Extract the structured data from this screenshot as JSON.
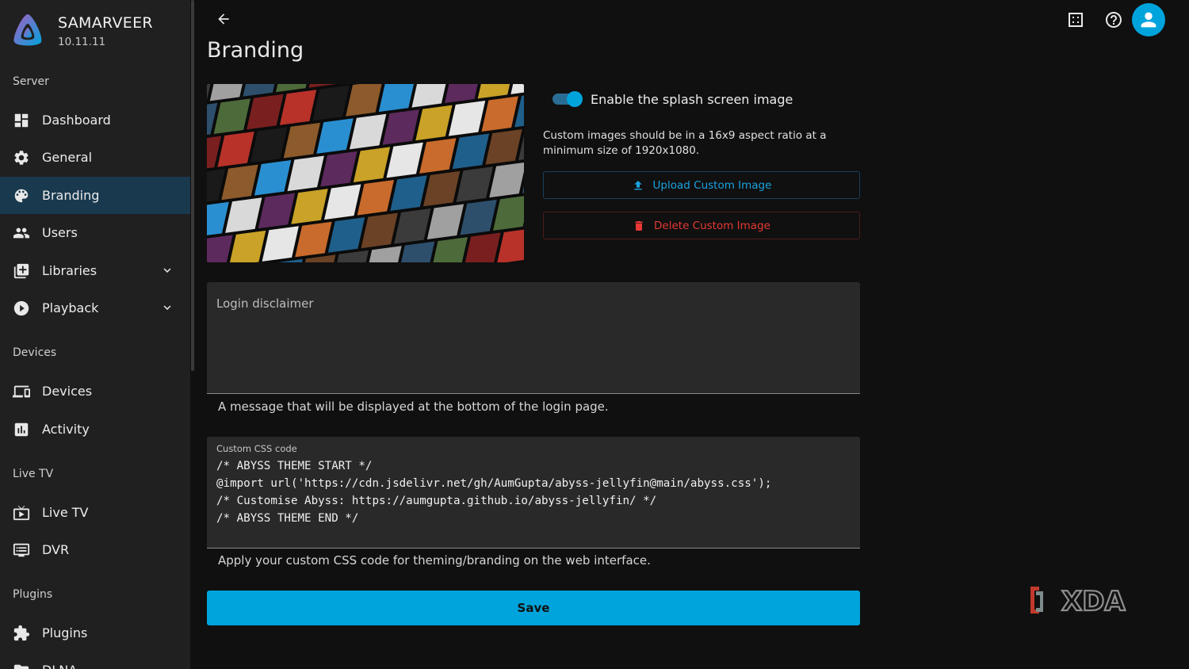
{
  "app": {
    "server_name": "SAMARVEER",
    "version": "10.11.11"
  },
  "sidebar": {
    "sections": [
      "Server",
      "Devices",
      "Live TV",
      "Plugins"
    ],
    "items": [
      {
        "label": "Dashboard",
        "icon": "dashboard-icon"
      },
      {
        "label": "General",
        "icon": "gear-icon"
      },
      {
        "label": "Branding",
        "icon": "palette-icon",
        "active": true
      },
      {
        "label": "Users",
        "icon": "people-icon"
      },
      {
        "label": "Libraries",
        "icon": "library-add-icon",
        "expandable": true
      },
      {
        "label": "Playback",
        "icon": "play-circle-icon",
        "expandable": true
      },
      {
        "label": "Devices",
        "icon": "devices-icon"
      },
      {
        "label": "Activity",
        "icon": "chart-icon"
      },
      {
        "label": "Live TV",
        "icon": "live-tv-icon"
      },
      {
        "label": "DVR",
        "icon": "dvr-icon"
      },
      {
        "label": "Plugins",
        "icon": "puzzle-icon"
      },
      {
        "label": "DLNA",
        "icon": "folder-icon"
      }
    ]
  },
  "header": {
    "title": "Branding"
  },
  "splash": {
    "toggle_label": "Enable the splash screen image",
    "enabled": true,
    "note": "Custom images should be in a 16x9 aspect ratio at a minimum size of 1920x1080.",
    "upload_label": "Upload Custom Image",
    "delete_label": "Delete Custom Image"
  },
  "login_disclaimer": {
    "placeholder": "Login disclaimer",
    "helper": "A message that will be displayed at the bottom of the login page."
  },
  "custom_css": {
    "label": "Custom CSS code",
    "code": "/* ABYSS THEME START */\n@import url('https://cdn.jsdelivr.net/gh/AumGupta/abyss-jellyfin@main/abyss.css');\n/* Customise Abyss: https://aumgupta.github.io/abyss-jellyfin/ */\n/* ABYSS THEME END */",
    "helper": "Apply your custom CSS code for theming/branding on the web interface."
  },
  "save_label": "Save",
  "watermark": "XDA",
  "colors": {
    "accent": "#00a4dc",
    "danger": "#e53935",
    "active_bg": "#19394f"
  }
}
